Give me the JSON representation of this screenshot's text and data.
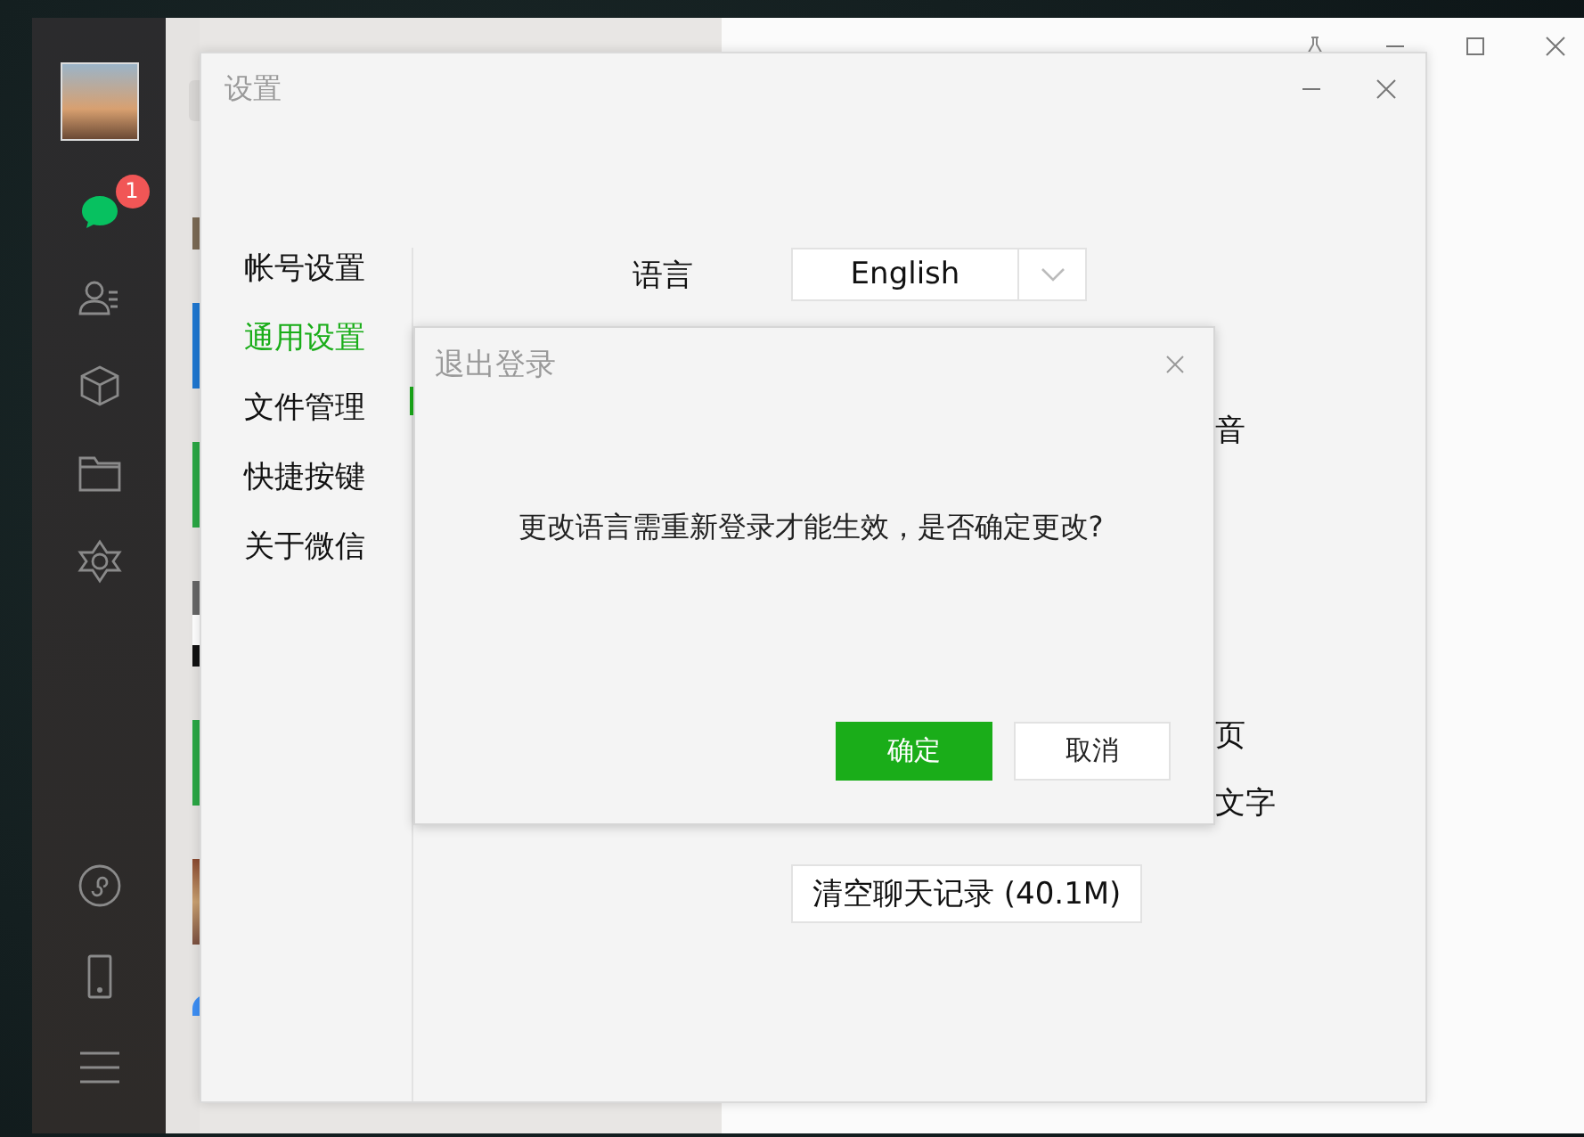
{
  "app_sidebar": {
    "items": [
      {
        "kind": "chats",
        "selected": true,
        "badge": "1"
      },
      {
        "kind": "contacts",
        "selected": false
      },
      {
        "kind": "favorites",
        "selected": false
      },
      {
        "kind": "files",
        "selected": false
      },
      {
        "kind": "moments",
        "selected": false
      },
      {
        "kind": "mini-programs",
        "selected": false
      },
      {
        "kind": "phone",
        "selected": false
      },
      {
        "kind": "menu",
        "selected": false
      }
    ]
  },
  "settings_window": {
    "title": "设置",
    "nav": [
      {
        "label": "帐号设置",
        "selected": false
      },
      {
        "label": "通用设置",
        "selected": true
      },
      {
        "label": "文件管理",
        "selected": false
      },
      {
        "label": "快捷按键",
        "selected": false
      },
      {
        "label": "关于微信",
        "selected": false
      }
    ],
    "language": {
      "label": "语言",
      "value": "English"
    },
    "partial_labels": [
      "音",
      "页",
      "文字"
    ],
    "clear_button": "清空聊天记录 (40.1M)"
  },
  "dialog": {
    "title": "退出登录",
    "message": "更改语言需重新登录才能生效，是否确定更改?",
    "buttons": [
      {
        "label": "确定",
        "kind": "primary"
      },
      {
        "label": "取消",
        "kind": "secondary"
      }
    ]
  }
}
